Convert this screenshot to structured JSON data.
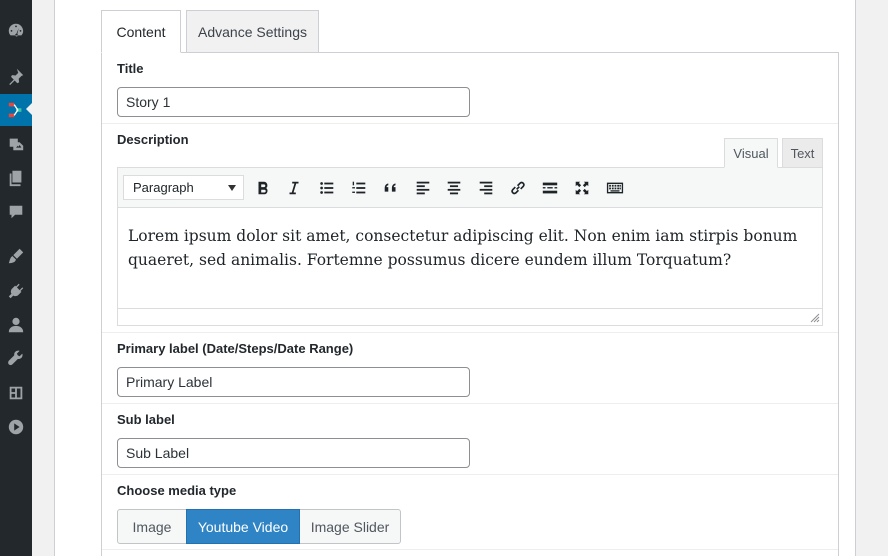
{
  "sidebar": {
    "items": [
      {
        "icon": "dashboard-icon"
      },
      {
        "icon": "pin-icon"
      },
      {
        "icon": "timeline-plugin-icon",
        "active": true
      },
      {
        "icon": "media-icon"
      },
      {
        "icon": "pages-icon"
      },
      {
        "icon": "comments-icon"
      },
      {
        "icon": "appearance-icon"
      },
      {
        "icon": "plugins-icon"
      },
      {
        "icon": "users-icon"
      },
      {
        "icon": "tools-icon"
      },
      {
        "icon": "settings-icon"
      },
      {
        "icon": "play-icon"
      }
    ]
  },
  "tabs": [
    {
      "label": "Content",
      "active": true
    },
    {
      "label": "Advance Settings",
      "active": false
    }
  ],
  "fields": {
    "title": {
      "label": "Title",
      "value": "Story 1"
    },
    "description": {
      "label": "Description",
      "editor_tabs": [
        "Visual",
        "Text"
      ],
      "format": "Paragraph",
      "content": "Lorem ipsum dolor sit amet, consectetur adipiscing elit. Non enim iam stirpis bonum quaeret, sed animalis. Fortemne possumus dicere eundem illum Torquatum?"
    },
    "primary_label": {
      "label": "Primary label (Date/Steps/Date Range)",
      "value": "Primary Label"
    },
    "sub_label": {
      "label": "Sub label",
      "value": "Sub Label"
    },
    "media_type": {
      "label": "Choose media type",
      "options": [
        "Image",
        "Youtube Video",
        "Image Slider"
      ],
      "selected": "Youtube Video"
    }
  },
  "toolbar_buttons": [
    "bold-icon",
    "italic-icon",
    "bullet-list-icon",
    "numbered-list-icon",
    "blockquote-icon",
    "align-left-icon",
    "align-center-icon",
    "align-right-icon",
    "link-icon",
    "read-more-icon",
    "fullscreen-icon",
    "toolbar-toggle-icon"
  ],
  "colors": {
    "accent": "#2e84c4",
    "sidebar": "#23282d",
    "active_menu": "#0073aa"
  }
}
